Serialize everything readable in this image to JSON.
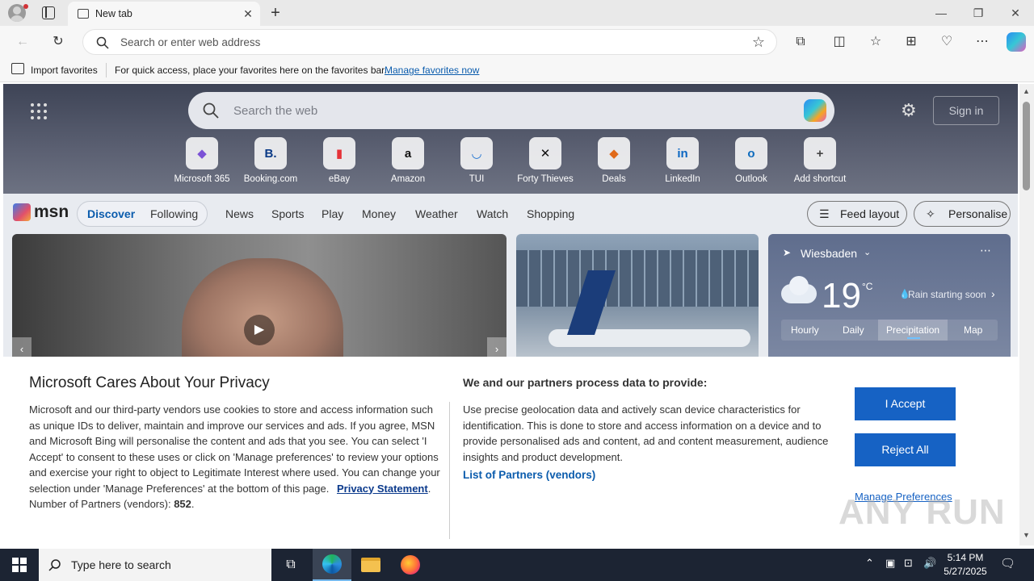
{
  "browser": {
    "tab_title": "New tab",
    "address_placeholder": "Search or enter web address"
  },
  "favorites_bar": {
    "import_label": "Import favorites",
    "hint": "For quick access, place your favorites here on the favorites bar.",
    "manage_link": "Manage favorites now"
  },
  "newtab": {
    "search_placeholder": "Search the web",
    "signin_label": "Sign in",
    "shortcuts": [
      {
        "label": "Microsoft 365",
        "glyph": "◆",
        "color": "#7b52d6"
      },
      {
        "label": "Booking.com",
        "glyph": "B.",
        "color": "#0a3a86"
      },
      {
        "label": "eBay",
        "glyph": "▮",
        "color": "#e53238"
      },
      {
        "label": "Amazon",
        "glyph": "a",
        "color": "#111111"
      },
      {
        "label": "TUI",
        "glyph": "◡",
        "color": "#1a6fd1"
      },
      {
        "label": "Forty Thieves",
        "glyph": "✕",
        "color": "#111111"
      },
      {
        "label": "Deals",
        "glyph": "◆",
        "color": "#e06a1a"
      },
      {
        "label": "LinkedIn",
        "glyph": "in",
        "color": "#0a66c2"
      },
      {
        "label": "Outlook",
        "glyph": "o",
        "color": "#0f6cbd"
      },
      {
        "label": "Add shortcut",
        "glyph": "+",
        "color": "#444444"
      }
    ]
  },
  "msn": {
    "logo": "msn",
    "tabs": {
      "discover": "Discover",
      "following": "Following"
    },
    "nav": [
      "News",
      "Sports",
      "Play",
      "Money",
      "Weather",
      "Watch",
      "Shopping"
    ],
    "feed_layout": "Feed layout",
    "personalise": "Personalise"
  },
  "weather": {
    "city": "Wiesbaden",
    "temp": "19",
    "unit": "°C",
    "note": "Rain starting soon",
    "tabs": [
      "Hourly",
      "Daily",
      "Precipitation",
      "Map"
    ]
  },
  "privacy": {
    "title": "Microsoft Cares About Your Privacy",
    "body": "Microsoft and our third-party vendors use cookies to store and access information such as unique IDs to deliver, maintain and improve our services and ads. If you agree, MSN and Microsoft Bing will personalise the content and ads that you see. You can select 'I Accept' to consent to these uses or click on 'Manage preferences' to review your options and exercise your right to object to Legitimate Interest where used.  You can change your selection under 'Manage Preferences' at the bottom of this page.",
    "privacy_link": "Privacy Statement",
    "partners_count_label": "Number of Partners (vendors):",
    "partners_count": "852",
    "right_heading": "We and our partners process data to provide:",
    "right_body": "Use precise geolocation data and actively scan device characteristics for identification. This is done to store and access information on a device and to provide personalised ads and content, ad and content measurement, audience insights and product development.",
    "partners_link": "List of Partners (vendors)",
    "accept": "I Accept",
    "reject": "Reject All",
    "manage": "Manage Preferences"
  },
  "taskbar": {
    "search_placeholder": "Type here to search",
    "time": "5:14 PM",
    "date": "5/27/2025"
  },
  "watermark": "ANY RUN"
}
